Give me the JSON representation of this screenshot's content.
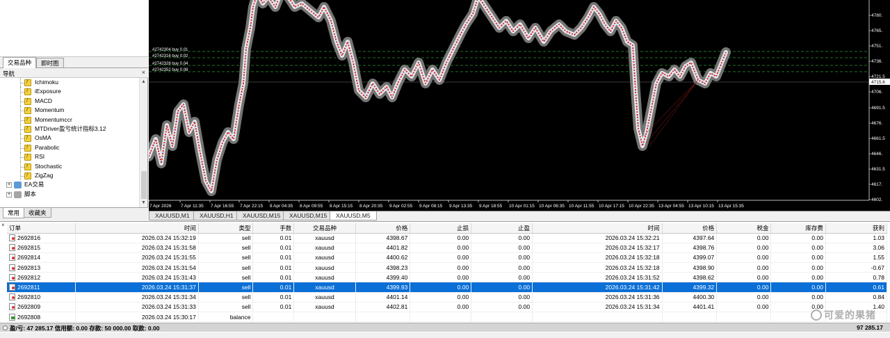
{
  "navigator": {
    "tabs_top": [
      "交易品种",
      "即时图"
    ],
    "header": "导航",
    "indicators": [
      "Ichimoku",
      "iExposure",
      "MACD",
      "Momentum",
      "Momentumccr",
      "MTDriver盈亏统计指标3.12",
      "OsMA",
      "Parabolic",
      "RSI",
      "Stochastic",
      "ZigZag"
    ],
    "groups": [
      "EA交易",
      "脚本"
    ],
    "tabs_bottom": [
      "常用",
      "收藏夹"
    ]
  },
  "chart": {
    "price_axis": [
      "4780.",
      "4765.",
      "4751.",
      "4736.",
      "4721.5",
      "4706.",
      "4691.5",
      "4676.",
      "4661.5",
      "4646.",
      "4631.5",
      "4617.",
      "4602."
    ],
    "current_price": "4715.6",
    "time_axis": [
      "7 Apr 2026",
      "7 Apr 11:35",
      "7 Apr 16:55",
      "7 Apr 22:15",
      "8 Apr 04:35",
      "8 Apr 09:55",
      "8 Apr 15:15",
      "8 Apr 20:35",
      "9 Apr 02:55",
      "9 Apr 08:15",
      "9 Apr 13:35",
      "9 Apr 18:55",
      "10 Apr 01:15",
      "10 Apr 06:35",
      "10 Apr 11:55",
      "10 Apr 17:15",
      "10 Apr 22:35",
      "13 Apr 04:55",
      "13 Apr 10:15",
      "13 Apr 15:35"
    ],
    "order_labels": [
      "#2742304 buy 0.01",
      "#2742316 buy 0.02",
      "#2742328 buy 0.04",
      "#2742352 buy 0.08"
    ],
    "colors": {
      "background": "#000000",
      "buy_marker": "#3a7bff",
      "sell_marker": "#e02020",
      "order_line": "#2a9d2a",
      "halo": "#8a8a8a"
    }
  },
  "chart_tabs": [
    "XAUUSD,M1",
    "XAUUSD,H1",
    "XAUUSD,M15",
    "XAUUSD,M15",
    "XAUUSD,M5"
  ],
  "terminal": {
    "columns": [
      "订单",
      "时间",
      "类型",
      "手数",
      "交易品种",
      "价格",
      "止损",
      "止盈",
      "时间",
      "价格",
      "税金",
      "库存费",
      "获利"
    ],
    "rows": [
      [
        "2692816",
        "2026.03.24 15:32:19",
        "sell",
        "0.01",
        "xauusd",
        "4398.67",
        "0.00",
        "0.00",
        "2026.03.24 15:32:21",
        "4397.64",
        "0.00",
        "0.00",
        "1.03"
      ],
      [
        "2692815",
        "2026.03.24 15:31:58",
        "sell",
        "0.01",
        "xauusd",
        "4401.82",
        "0.00",
        "0.00",
        "2026.03.24 15:32:17",
        "4398.76",
        "0.00",
        "0.00",
        "3.06"
      ],
      [
        "2692814",
        "2026.03.24 15:31:55",
        "sell",
        "0.01",
        "xauusd",
        "4400.62",
        "0.00",
        "0.00",
        "2026.03.24 15:32:18",
        "4399.07",
        "0.00",
        "0.00",
        "1.55"
      ],
      [
        "2692813",
        "2026.03.24 15:31:54",
        "sell",
        "0.01",
        "xauusd",
        "4398.23",
        "0.00",
        "0.00",
        "2026.03.24 15:32:18",
        "4398.90",
        "0.00",
        "0.00",
        "-0.67"
      ],
      [
        "2692812",
        "2026.03.24 15:31:43",
        "sell",
        "0.01",
        "xauusd",
        "4399.40",
        "0.00",
        "0.00",
        "2026.03.24 15:31:52",
        "4398.62",
        "0.00",
        "0.00",
        "0.78"
      ],
      [
        "2692811",
        "2026.03.24 15:31:37",
        "sell",
        "0.01",
        "xauusd",
        "4399.93",
        "0.00",
        "0.00",
        "2026.03.24 15:31:42",
        "4399.32",
        "0.00",
        "0.00",
        "0.61"
      ],
      [
        "2692810",
        "2026.03.24 15:31:34",
        "sell",
        "0.01",
        "xauusd",
        "4401.14",
        "0.00",
        "0.00",
        "2026.03.24 15:31:36",
        "4400.30",
        "0.00",
        "0.00",
        "0.84"
      ],
      [
        "2692809",
        "2026.03.24 15:31:33",
        "sell",
        "0.01",
        "xauusd",
        "4402.81",
        "0.00",
        "0.00",
        "2026.03.24 15:31:34",
        "4401.41",
        "0.00",
        "0.00",
        "1.40"
      ]
    ],
    "balance_row": {
      "order": "2692808",
      "time": "2026.03.24 15:30:17",
      "type": "balance"
    },
    "summary": "盈/亏: 47 285.17  信用额: 0.00  存款: 50 000.00  取款: 0.00",
    "total": "97 285.17"
  },
  "watermark": "可爱的果猪"
}
